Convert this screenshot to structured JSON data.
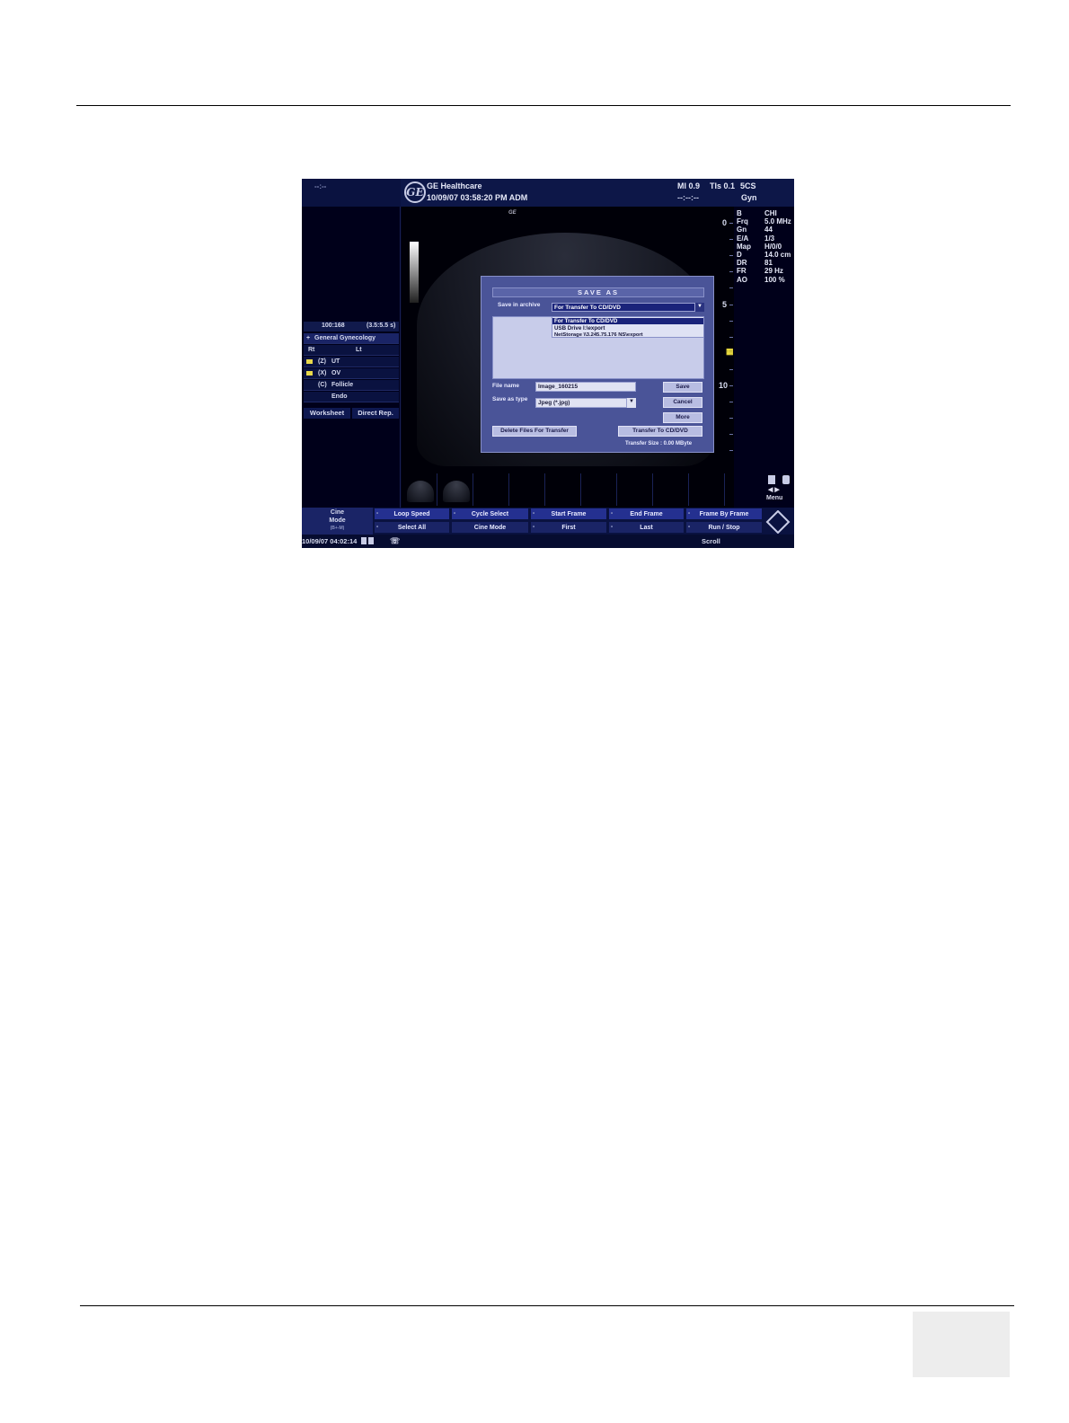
{
  "header": {
    "left_dash": "--:--",
    "brand": "GE Healthcare",
    "logo_text": "GE",
    "datetime": "10/09/07 03:58:20 PM ADM",
    "mi": "MI 0.9",
    "tis": "TIs 0.1",
    "probe": "5CS",
    "time_dash": "--:--:--",
    "preset": "Gyn"
  },
  "left_panel": {
    "ratio_left": "100:168",
    "ratio_right": "(3.5:5.5 s)",
    "study": "General Gynecology",
    "study_prefix": "+",
    "side_rt": "Rt",
    "side_lt": "Lt",
    "items": [
      {
        "prefix": "(Z)",
        "label": "UT"
      },
      {
        "prefix": "(X)",
        "label": "OV"
      },
      {
        "prefix": "(C)",
        "label": "Follicle"
      },
      {
        "prefix": "",
        "label": "Endo"
      }
    ],
    "worksheet": "Worksheet",
    "direct_rep": "Direct Rep."
  },
  "image": {
    "small_logo": "GE"
  },
  "params": [
    {
      "k": "B",
      "v": "CHI"
    },
    {
      "k": "Frq",
      "v": "5.0 MHz"
    },
    {
      "k": "Gn",
      "v": "44"
    },
    {
      "k": "E/A",
      "v": "1/3"
    },
    {
      "k": "Map",
      "v": "H/0/0"
    },
    {
      "k": "D",
      "v": "14.0 cm"
    },
    {
      "k": "DR",
      "v": "81"
    },
    {
      "k": "FR",
      "v": "29 Hz"
    },
    {
      "k": "AO",
      "v": "100 %"
    }
  ],
  "depth_marks": [
    "0",
    "5",
    "10"
  ],
  "dialog": {
    "title": "SAVE AS",
    "archive_label": "Save in archive",
    "archive_value": "For Transfer To CD/DVD",
    "options": [
      "For Transfer To CD/DVD",
      "USB Drive    I:\\export",
      "NetStorage   \\\\3.245.75.176 NS\\export"
    ],
    "file_name_label": "File name",
    "file_name_value": "Image_160215",
    "save_type_label": "Save as type",
    "save_type_value": "Jpeg  (*.jpg)",
    "save_button": "Save",
    "cancel_button": "Cancel",
    "more_button": "More",
    "delete_button": "Delete Files For Transfer",
    "transfer_button": "Transfer To CD/DVD",
    "transfer_size": "Transfer Size : 0.00 MByte"
  },
  "menu": {
    "label": "Menu"
  },
  "softkeys": {
    "cine_mode": [
      "Cine",
      "Mode",
      "(B+-M)"
    ],
    "top": [
      "Loop Speed",
      "Cycle Select",
      "Start Frame",
      "End Frame",
      "Frame By Frame"
    ],
    "bottom": [
      "Select All",
      "Cine Mode",
      "First",
      "Last",
      "Run / Stop"
    ]
  },
  "status": {
    "datetime": "10/09/07 04:02:14",
    "scroll": "Scroll"
  }
}
